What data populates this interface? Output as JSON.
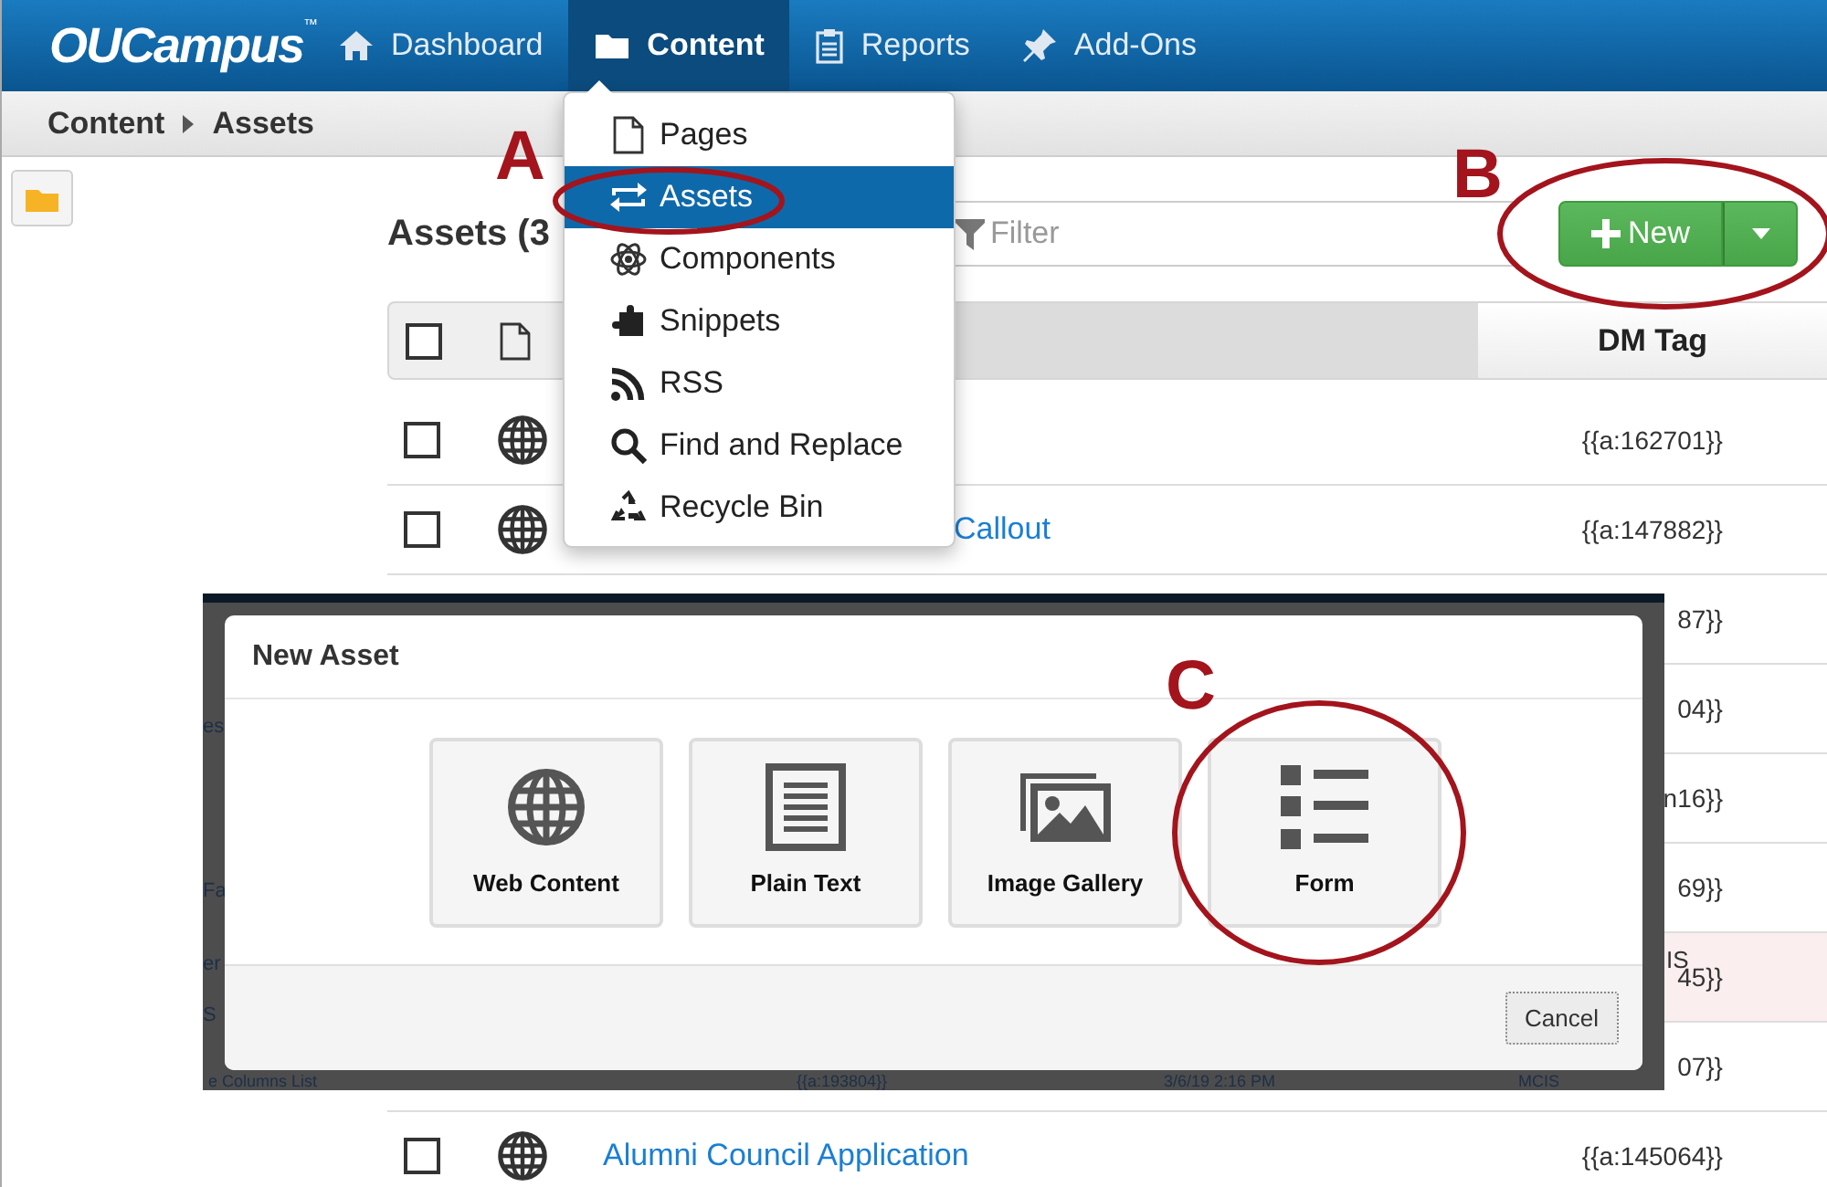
{
  "nav": {
    "logo": "OUCampus",
    "logo_mark": "™",
    "items": [
      {
        "label": "Dashboard",
        "selected": false
      },
      {
        "label": "Content",
        "selected": true
      },
      {
        "label": "Reports",
        "selected": false
      },
      {
        "label": "Add-Ons",
        "selected": false
      }
    ]
  },
  "breadcrumb": [
    "Content",
    "Assets"
  ],
  "content_menu": {
    "items": [
      {
        "label": "Pages",
        "selected": false
      },
      {
        "label": "Assets",
        "selected": true
      },
      {
        "label": "Components",
        "selected": false
      },
      {
        "label": "Snippets",
        "selected": false
      },
      {
        "label": "RSS",
        "selected": false
      },
      {
        "label": "Find and Replace",
        "selected": false
      },
      {
        "label": "Recycle Bin",
        "selected": false
      }
    ]
  },
  "page_title": "Assets (3",
  "filter": {
    "placeholder": "Filter"
  },
  "new_button": {
    "label": "New"
  },
  "table": {
    "header": {
      "checked": false,
      "dm_tag": "DM Tag"
    },
    "rows": [
      {
        "kind": "web",
        "checked": false,
        "tag": "{{a:162701}}",
        "highlighted": false
      },
      {
        "kind": "web",
        "checked": false,
        "name": "Callout",
        "tag": "{{a:147882}}",
        "highlighted": false
      },
      {
        "kind": "covered",
        "tag": "87}}",
        "highlighted": false
      },
      {
        "kind": "covered",
        "tag": "04}}",
        "highlighted": false
      },
      {
        "kind": "covered",
        "tag": "n16}}",
        "highlighted": false
      },
      {
        "kind": "covered",
        "tag": "69}}",
        "highlighted": false
      },
      {
        "kind": "covered",
        "tag": "45}}",
        "fragment": "IS",
        "highlighted": true
      },
      {
        "kind": "covered",
        "tag": "07}}",
        "highlighted": false
      },
      {
        "kind": "web",
        "checked": false,
        "name": "Alumni Council Application",
        "tag": "{{a:145064}}",
        "highlighted": false
      }
    ]
  },
  "dialog": {
    "title": "New Asset",
    "options": [
      {
        "label": "Web Content"
      },
      {
        "label": "Plain Text"
      },
      {
        "label": "Image Gallery"
      },
      {
        "label": "Form"
      }
    ],
    "cancel": "Cancel",
    "behind_left": [
      "es",
      "Fa",
      "er",
      "S"
    ],
    "behind_bottom": [
      "e Columns List",
      "{{a:193804}}",
      "3/6/19 2:16 PM",
      "MCIS"
    ]
  },
  "annotations": [
    {
      "label": "A"
    },
    {
      "label": "B"
    },
    {
      "label": "C"
    }
  ]
}
